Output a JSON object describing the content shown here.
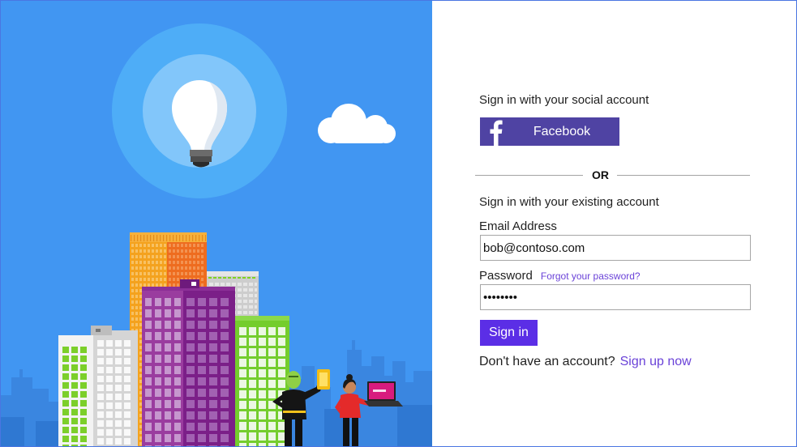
{
  "theme": {
    "hero_background": "#4196f2",
    "facebook": "#4f43a3",
    "primary": "#5b2ee6",
    "link": "#6a42d8"
  },
  "social": {
    "heading": "Sign in with your social account",
    "facebook": {
      "label": "Facebook",
      "icon": "facebook-f-icon"
    }
  },
  "divider": {
    "label": "OR"
  },
  "local": {
    "heading": "Sign in with your existing account",
    "email": {
      "label": "Email Address",
      "value": "bob@contoso.com"
    },
    "password": {
      "label": "Password",
      "value": "••••••••",
      "forgot_link": "Forgot your password?"
    },
    "submit": {
      "label": "Sign in"
    }
  },
  "signup": {
    "prompt": "Don't have an account?",
    "link": "Sign up now"
  }
}
